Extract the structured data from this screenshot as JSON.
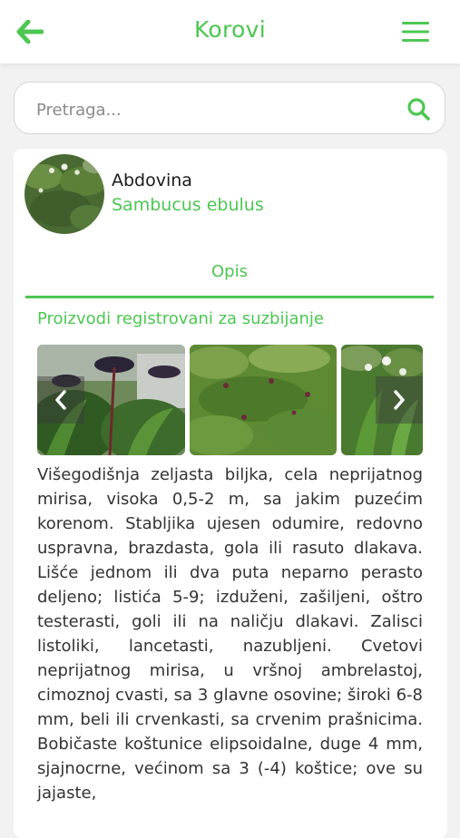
{
  "header": {
    "title": "Korovi",
    "back_icon": "arrow-left-icon",
    "menu_icon": "hamburger-menu-icon",
    "accent": "#4cc752"
  },
  "search": {
    "placeholder": "Pretraga...",
    "icon": "search-icon"
  },
  "plant": {
    "common_name": "Abdovina",
    "latin_name": "Sambucus ebulus",
    "tab_label": "Opis",
    "products_link": "Proizvodi registrovani za suzbijanje",
    "gallery_images": [
      "plant-photo-dark-berries",
      "plant-photo-field",
      "plant-photo-white-flowers"
    ],
    "description": "Višegodišnja zeljasta biljka, cela neprijatnog mirisa, visoka 0,5-2 m, sa jakim puzećim korenom. Stabljika ujesen odumire, redovno uspravna, brazdasta, gola ili rasuto dlakava. Lišće jednom ili dva puta neparno perasto deljeno; listića 5-9; izduženi, zašiljeni, oštro testerasti, goli ili na naličju dlakavi. Zalisci listoliki, lancetasti, nazubljeni. Cvetovi neprijatnog mirisa, u vršnoj ambrelastoj, cimoznoj cvasti, sa 3 glavne osovine; široki 6-8 mm, beli ili crvenkasti, sa crvenim prašnicima. Bobičaste koštunice elipsoidalne, duge 4 mm, sjajnocrne, većinom sa 3 (-4) koštice; ove su jajaste,"
  }
}
